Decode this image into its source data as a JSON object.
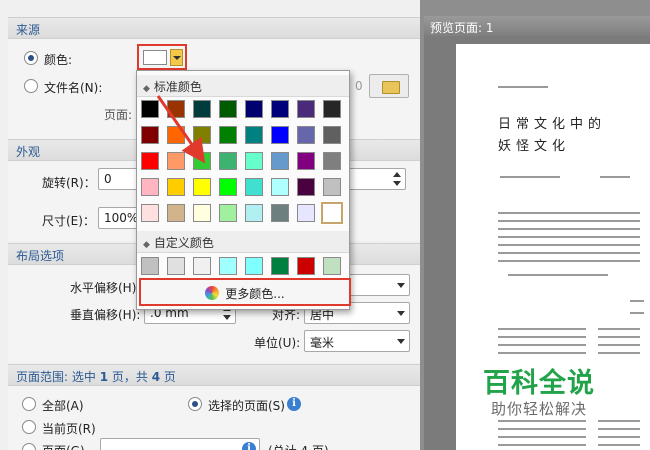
{
  "source": {
    "header": "来源",
    "color_radio": "颜色:",
    "file_radio": "文件名(N):",
    "file_page_value": "0",
    "page_label": "页面:"
  },
  "appearance": {
    "header": "外观",
    "rotate_label": "旋转(R)：",
    "rotate_value": "0",
    "size_label": "尺寸(E)：",
    "size_value": "100%"
  },
  "layout": {
    "header": "布局选项",
    "h_offset_label": "水平偏移(H)",
    "v_offset_label": "垂直偏移(H):",
    "v_offset_value": ".0 mm",
    "align_label": "对齐:",
    "align_value": "居中",
    "unit_label": "单位(U):",
    "unit_value": "毫米"
  },
  "page_range": {
    "header_prefix": "页面范围: 选中 ",
    "selected_count": "1",
    "header_mid": " 页，共 ",
    "total_count": "4",
    "header_suffix": " 页",
    "all_label": "全部(A)",
    "selected_pages_label": "选择的页面(S)",
    "current_page_label": "当前页(R)",
    "pages_label": "页面(G)",
    "total_hint": "(总计 4 页)"
  },
  "color_popup": {
    "standard_title": "标准颜色",
    "custom_title": "自定义颜色",
    "more_colors": "更多颜色...",
    "standard_rows": [
      [
        "#000000",
        "#993300",
        "#003c3c",
        "#005a00",
        "#00006e",
        "#00007a",
        "#4b2a7a",
        "#262626"
      ],
      [
        "#800000",
        "#ff6600",
        "#808000",
        "#008000",
        "#008080",
        "#0000ff",
        "#6666aa",
        "#606060"
      ],
      [
        "#ff0000",
        "#ff9966",
        "#33cc33",
        "#3cb371",
        "#66ffcc",
        "#6699cc",
        "#800080",
        "#7f7f7f"
      ],
      [
        "#ffb6c1",
        "#ffcc00",
        "#ffff00",
        "#00ff00",
        "#40e0d0",
        "#b0ffff",
        "#4b0040",
        "#c0c0c0"
      ],
      [
        "#ffe0e0",
        "#d2b48c",
        "#ffffe0",
        "#a0f0a0",
        "#b0f0f0",
        "#6e7f80",
        "#e6e6ff",
        "#ffffff"
      ]
    ],
    "custom_row": [
      "#c0c0c0",
      "#e0e0e0",
      "#f0f0f0",
      "#a0ffff",
      "#80ffff",
      "#008040",
      "#cc0000",
      "#c0e0c0"
    ]
  },
  "preview": {
    "title": "预览页面: 1",
    "doc_title_line1": "日常文化中的",
    "doc_title_line2": "妖怪文化",
    "watermark_title": "百科全说",
    "watermark_sub": "助你轻松解决"
  }
}
